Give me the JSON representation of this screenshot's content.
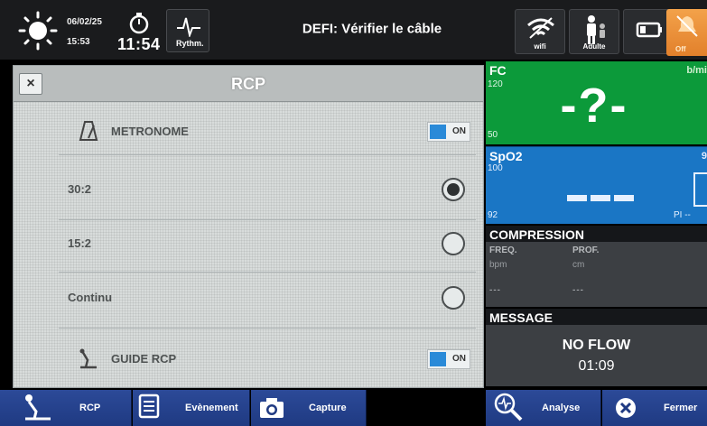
{
  "topbar": {
    "date": "06/02/25",
    "time": "15:53",
    "clock": "11:54",
    "rythm_label": "Rythm.",
    "alarm": "DEFI: Vérifier le câble",
    "wifi_label": "wifi",
    "patient_label": "Adulte",
    "off_label": "Off"
  },
  "dialog": {
    "title": "RCP",
    "close_label": "×",
    "metronome": {
      "label": "METRONOME",
      "toggle": "ON"
    },
    "options": [
      {
        "label": "30:2",
        "selected": true
      },
      {
        "label": "15:2",
        "selected": false
      },
      {
        "label": "Continu",
        "selected": false
      }
    ],
    "guide": {
      "label": "GUIDE RCP",
      "toggle": "ON"
    }
  },
  "fc": {
    "title": "FC",
    "unit": "b/mi",
    "high": "120",
    "low": "50",
    "value": "-?-"
  },
  "spo2": {
    "title": "SpO2",
    "unit": "9",
    "high": "100",
    "low": "92",
    "pi": "PI  --"
  },
  "compression": {
    "title": "COMPRESSION",
    "freq_label": "FREQ.",
    "freq_unit": "bpm",
    "freq_value": "---",
    "prof_label": "PROF.",
    "prof_unit": "cm",
    "prof_value": "---"
  },
  "message": {
    "title": "MESSAGE",
    "line1": "NO FLOW",
    "line2": "01:09"
  },
  "bottombar": {
    "rcp": "RCP",
    "events": "Evènement",
    "capture": "Capture",
    "analyse": "Analyse",
    "close": "Fermer"
  },
  "colors": {
    "fc_green": "#0c9a3a",
    "spo2_blue": "#1a76c5",
    "button_blue": "#2c4a98",
    "toggle_blue": "#2a8ad8",
    "off_orange": "#f3a24a"
  }
}
